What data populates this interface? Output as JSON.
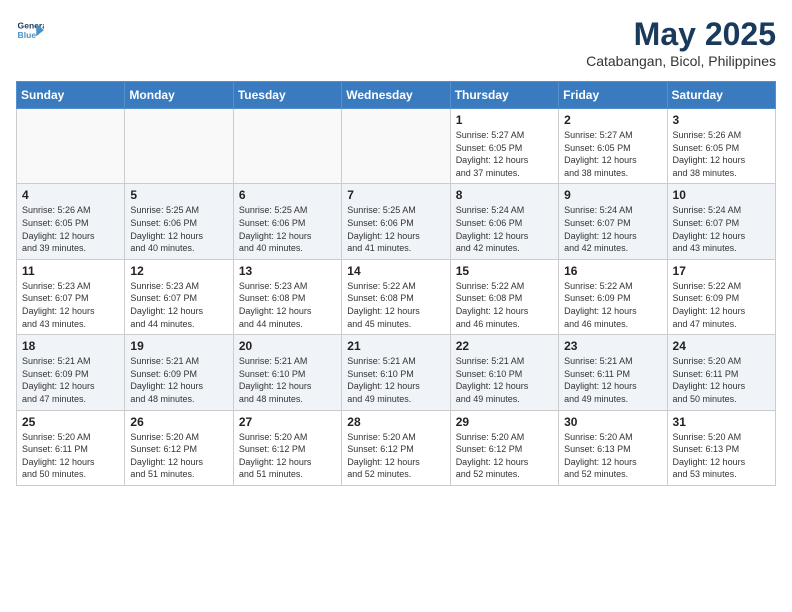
{
  "header": {
    "logo_line1": "General",
    "logo_line2": "Blue",
    "title": "May 2025",
    "subtitle": "Catabangan, Bicol, Philippines"
  },
  "weekdays": [
    "Sunday",
    "Monday",
    "Tuesday",
    "Wednesday",
    "Thursday",
    "Friday",
    "Saturday"
  ],
  "weeks": [
    [
      {
        "day": "",
        "info": ""
      },
      {
        "day": "",
        "info": ""
      },
      {
        "day": "",
        "info": ""
      },
      {
        "day": "",
        "info": ""
      },
      {
        "day": "1",
        "info": "Sunrise: 5:27 AM\nSunset: 6:05 PM\nDaylight: 12 hours\nand 37 minutes."
      },
      {
        "day": "2",
        "info": "Sunrise: 5:27 AM\nSunset: 6:05 PM\nDaylight: 12 hours\nand 38 minutes."
      },
      {
        "day": "3",
        "info": "Sunrise: 5:26 AM\nSunset: 6:05 PM\nDaylight: 12 hours\nand 38 minutes."
      }
    ],
    [
      {
        "day": "4",
        "info": "Sunrise: 5:26 AM\nSunset: 6:05 PM\nDaylight: 12 hours\nand 39 minutes."
      },
      {
        "day": "5",
        "info": "Sunrise: 5:25 AM\nSunset: 6:06 PM\nDaylight: 12 hours\nand 40 minutes."
      },
      {
        "day": "6",
        "info": "Sunrise: 5:25 AM\nSunset: 6:06 PM\nDaylight: 12 hours\nand 40 minutes."
      },
      {
        "day": "7",
        "info": "Sunrise: 5:25 AM\nSunset: 6:06 PM\nDaylight: 12 hours\nand 41 minutes."
      },
      {
        "day": "8",
        "info": "Sunrise: 5:24 AM\nSunset: 6:06 PM\nDaylight: 12 hours\nand 42 minutes."
      },
      {
        "day": "9",
        "info": "Sunrise: 5:24 AM\nSunset: 6:07 PM\nDaylight: 12 hours\nand 42 minutes."
      },
      {
        "day": "10",
        "info": "Sunrise: 5:24 AM\nSunset: 6:07 PM\nDaylight: 12 hours\nand 43 minutes."
      }
    ],
    [
      {
        "day": "11",
        "info": "Sunrise: 5:23 AM\nSunset: 6:07 PM\nDaylight: 12 hours\nand 43 minutes."
      },
      {
        "day": "12",
        "info": "Sunrise: 5:23 AM\nSunset: 6:07 PM\nDaylight: 12 hours\nand 44 minutes."
      },
      {
        "day": "13",
        "info": "Sunrise: 5:23 AM\nSunset: 6:08 PM\nDaylight: 12 hours\nand 44 minutes."
      },
      {
        "day": "14",
        "info": "Sunrise: 5:22 AM\nSunset: 6:08 PM\nDaylight: 12 hours\nand 45 minutes."
      },
      {
        "day": "15",
        "info": "Sunrise: 5:22 AM\nSunset: 6:08 PM\nDaylight: 12 hours\nand 46 minutes."
      },
      {
        "day": "16",
        "info": "Sunrise: 5:22 AM\nSunset: 6:09 PM\nDaylight: 12 hours\nand 46 minutes."
      },
      {
        "day": "17",
        "info": "Sunrise: 5:22 AM\nSunset: 6:09 PM\nDaylight: 12 hours\nand 47 minutes."
      }
    ],
    [
      {
        "day": "18",
        "info": "Sunrise: 5:21 AM\nSunset: 6:09 PM\nDaylight: 12 hours\nand 47 minutes."
      },
      {
        "day": "19",
        "info": "Sunrise: 5:21 AM\nSunset: 6:09 PM\nDaylight: 12 hours\nand 48 minutes."
      },
      {
        "day": "20",
        "info": "Sunrise: 5:21 AM\nSunset: 6:10 PM\nDaylight: 12 hours\nand 48 minutes."
      },
      {
        "day": "21",
        "info": "Sunrise: 5:21 AM\nSunset: 6:10 PM\nDaylight: 12 hours\nand 49 minutes."
      },
      {
        "day": "22",
        "info": "Sunrise: 5:21 AM\nSunset: 6:10 PM\nDaylight: 12 hours\nand 49 minutes."
      },
      {
        "day": "23",
        "info": "Sunrise: 5:21 AM\nSunset: 6:11 PM\nDaylight: 12 hours\nand 49 minutes."
      },
      {
        "day": "24",
        "info": "Sunrise: 5:20 AM\nSunset: 6:11 PM\nDaylight: 12 hours\nand 50 minutes."
      }
    ],
    [
      {
        "day": "25",
        "info": "Sunrise: 5:20 AM\nSunset: 6:11 PM\nDaylight: 12 hours\nand 50 minutes."
      },
      {
        "day": "26",
        "info": "Sunrise: 5:20 AM\nSunset: 6:12 PM\nDaylight: 12 hours\nand 51 minutes."
      },
      {
        "day": "27",
        "info": "Sunrise: 5:20 AM\nSunset: 6:12 PM\nDaylight: 12 hours\nand 51 minutes."
      },
      {
        "day": "28",
        "info": "Sunrise: 5:20 AM\nSunset: 6:12 PM\nDaylight: 12 hours\nand 52 minutes."
      },
      {
        "day": "29",
        "info": "Sunrise: 5:20 AM\nSunset: 6:12 PM\nDaylight: 12 hours\nand 52 minutes."
      },
      {
        "day": "30",
        "info": "Sunrise: 5:20 AM\nSunset: 6:13 PM\nDaylight: 12 hours\nand 52 minutes."
      },
      {
        "day": "31",
        "info": "Sunrise: 5:20 AM\nSunset: 6:13 PM\nDaylight: 12 hours\nand 53 minutes."
      }
    ]
  ]
}
